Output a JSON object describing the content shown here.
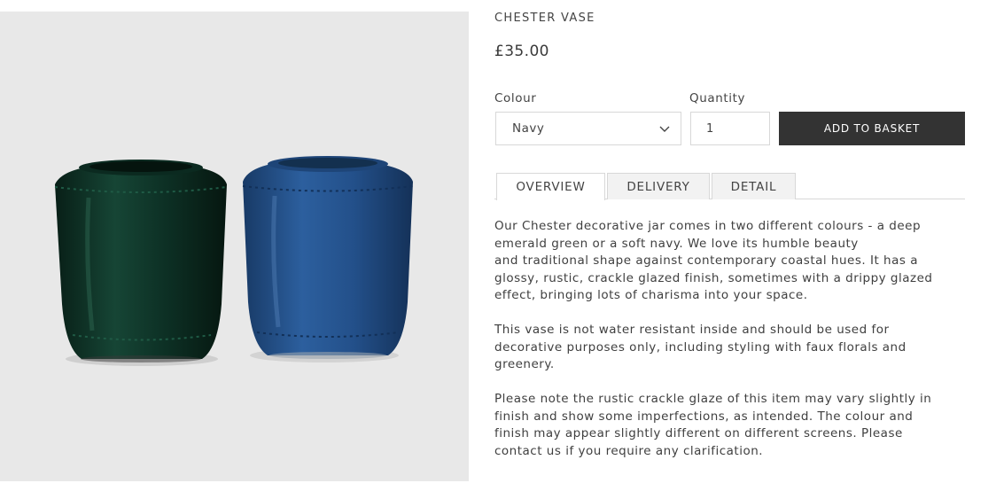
{
  "product": {
    "title": "CHESTER VASE",
    "price": "£35.00",
    "image_alt": "Two glazed vases, one emerald green and one navy"
  },
  "options": {
    "colour_label": "Colour",
    "colour_value": "Navy",
    "quantity_label": "Quantity",
    "quantity_value": "1",
    "add_button_label": "ADD TO BASKET"
  },
  "tabs": [
    {
      "label": "OVERVIEW",
      "active": true
    },
    {
      "label": "DELIVERY",
      "active": false
    },
    {
      "label": "DETAIL",
      "active": false
    }
  ],
  "overview": {
    "paragraphs": [
      "Our Chester decorative jar comes in two different colours - a deep\nemerald green or a soft navy. We love its humble beauty\nand traditional shape against contemporary coastal hues. It has a\nglossy, rustic, crackle glazed finish, sometimes with a drippy glazed\neffect, bringing lots of charisma into your space.",
      "This vase is not water resistant inside and should be used for\ndecorative purposes only, including styling with faux florals and\ngreenery.",
      "Please note the rustic crackle glaze of this item may vary slightly in\nfinish and show some imperfections, as intended. The colour and\nfinish may appear slightly different on different screens. Please\ncontact us if you require any clarification."
    ]
  },
  "colors": {
    "button_bg": "#333333",
    "image_bg": "#e8e8e8",
    "green_vase": "#0f3327",
    "navy_vase": "#23508a"
  },
  "icons": {
    "dropdown": "chevron-down-icon"
  }
}
